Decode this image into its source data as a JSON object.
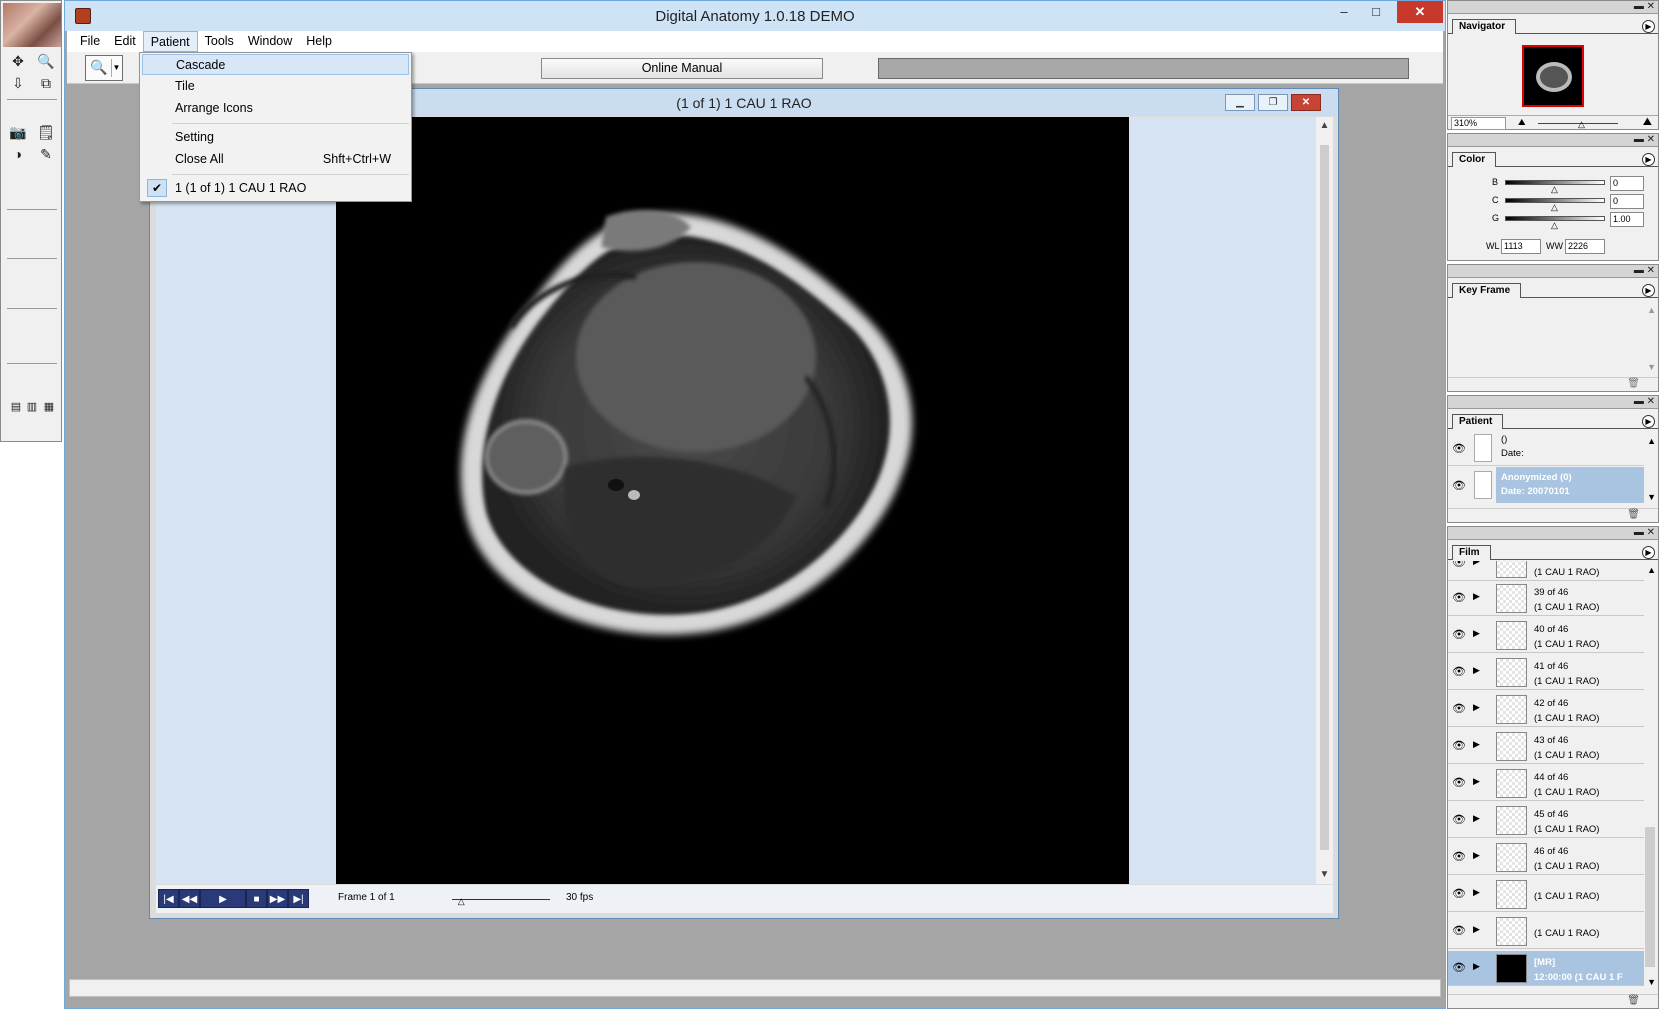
{
  "app": {
    "title": "Digital Anatomy 1.0.18 DEMO",
    "window_buttons": {
      "minimize": "–",
      "maximize": "□",
      "close": "✕"
    }
  },
  "menu": {
    "items": [
      "File",
      "Edit",
      "Patient",
      "Tools",
      "Window",
      "Help"
    ],
    "active": "Patient"
  },
  "toolbar": {
    "manual_label": "Online Manual",
    "zoom_icon": "magnifier-icon"
  },
  "dropdown": {
    "items": [
      {
        "label": "Cascade",
        "shortcut": ""
      },
      {
        "label": "Tile",
        "shortcut": ""
      },
      {
        "label": "Arrange Icons",
        "shortcut": ""
      },
      {
        "label": "Setting",
        "shortcut": ""
      },
      {
        "label": "Close All",
        "shortcut": "Shft+Ctrl+W"
      },
      {
        "label": "1 (1 of 1) 1 CAU 1 RAO",
        "shortcut": "",
        "checked": true
      }
    ],
    "highlighted": "Cascade"
  },
  "child_window": {
    "title": "(1 of 1) 1 CAU 1 RAO",
    "frame_text": "Frame 1 of 1",
    "fps_text": "30 fps",
    "playback_level": 0.1
  },
  "navigator": {
    "tab": "Navigator",
    "zoom": "310%",
    "zoom_level": 0.55
  },
  "color": {
    "tab": "Color",
    "b_label": "B",
    "b_value": "0",
    "c_label": "C",
    "c_value": "0",
    "g_label": "G",
    "g_value": "1.00",
    "wl_label": "WL",
    "wl_value": "1113",
    "ww_label": "WW",
    "ww_value": "2226"
  },
  "keyframe": {
    "tab": "Key Frame"
  },
  "patient": {
    "tab": "Patient",
    "rows": [
      {
        "l1": "()",
        "l2": "Date:"
      },
      {
        "l1": "Anonymized (0)",
        "l2": "Date: 20070101"
      }
    ]
  },
  "film": {
    "tab": "Film",
    "rows": [
      {
        "l1": "",
        "l2": "(1 CAU 1 RAO)"
      },
      {
        "l1": "39 of 46",
        "l2": "(1 CAU 1 RAO)"
      },
      {
        "l1": "40 of 46",
        "l2": "(1 CAU 1 RAO)"
      },
      {
        "l1": "41 of 46",
        "l2": "(1 CAU 1 RAO)"
      },
      {
        "l1": "42 of 46",
        "l2": "(1 CAU 1 RAO)"
      },
      {
        "l1": "43 of 46",
        "l2": "(1 CAU 1 RAO)"
      },
      {
        "l1": "44 of 46",
        "l2": "(1 CAU 1 RAO)"
      },
      {
        "l1": "45 of 46",
        "l2": "(1 CAU 1 RAO)"
      },
      {
        "l1": "46 of 46",
        "l2": "(1 CAU 1 RAO)"
      },
      {
        "l1": "",
        "l2": "(1 CAU 1 RAO)"
      },
      {
        "l1": "",
        "l2": "(1 CAU 1 RAO)"
      },
      {
        "l1": "[MR]",
        "l2": "12:00:00 (1 CAU 1 F"
      }
    ]
  }
}
